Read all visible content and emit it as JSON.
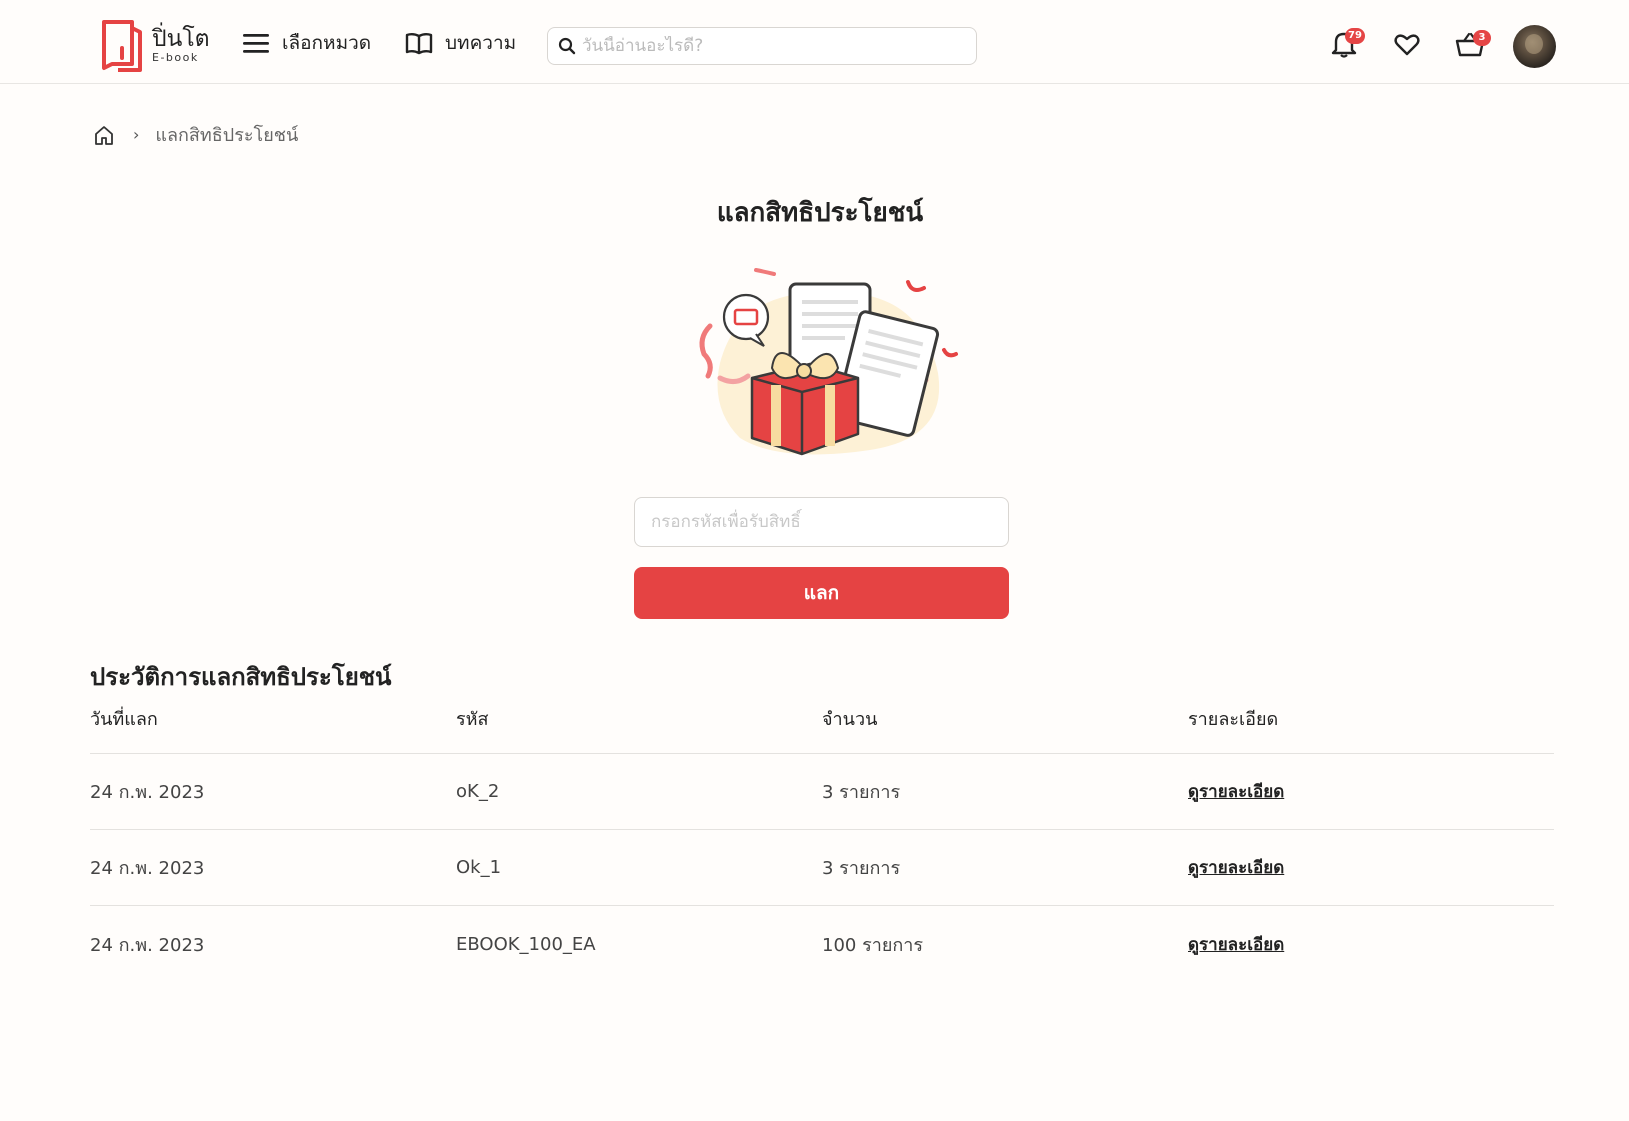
{
  "header": {
    "logo_title": "ปิ่นโต",
    "logo_sub": "E-book",
    "nav_categories": "เลือกหมวด",
    "nav_articles": "บทความ",
    "search_placeholder": "วันนี้อ่านอะไรดี?",
    "notification_count": "79",
    "cart_count": "3"
  },
  "breadcrumb": {
    "current": "แลกสิทธิประโยชน์"
  },
  "main": {
    "title": "แลกสิทธิประโยชน์",
    "code_placeholder": "กรอกรหัสเพื่อรับสิทธิ์",
    "redeem_label": "แลก"
  },
  "history": {
    "title": "ประวัติการแลกสิทธิประโยชน์",
    "columns": [
      "วันที่แลก",
      "รหัส",
      "จำนวน",
      "รายละเอียด"
    ],
    "rows": [
      {
        "date": "24 ก.พ. 2023",
        "code": "oK_2",
        "amount": "3 รายการ",
        "detail": "ดูรายละเอียด"
      },
      {
        "date": "24 ก.พ. 2023",
        "code": "Ok_1",
        "amount": "3 รายการ",
        "detail": "ดูรายละเอียด"
      },
      {
        "date": "24 ก.พ. 2023",
        "code": "EBOOK_100_EA",
        "amount": "100 รายการ",
        "detail": "ดูรายละเอียด"
      }
    ]
  },
  "colors": {
    "accent": "#e54343",
    "background": "#fffdfb"
  },
  "icons": [
    "logo-icon",
    "menu-icon",
    "book-icon",
    "search-icon",
    "bell-icon",
    "heart-icon",
    "basket-icon",
    "home-icon",
    "chevron-right-icon"
  ]
}
